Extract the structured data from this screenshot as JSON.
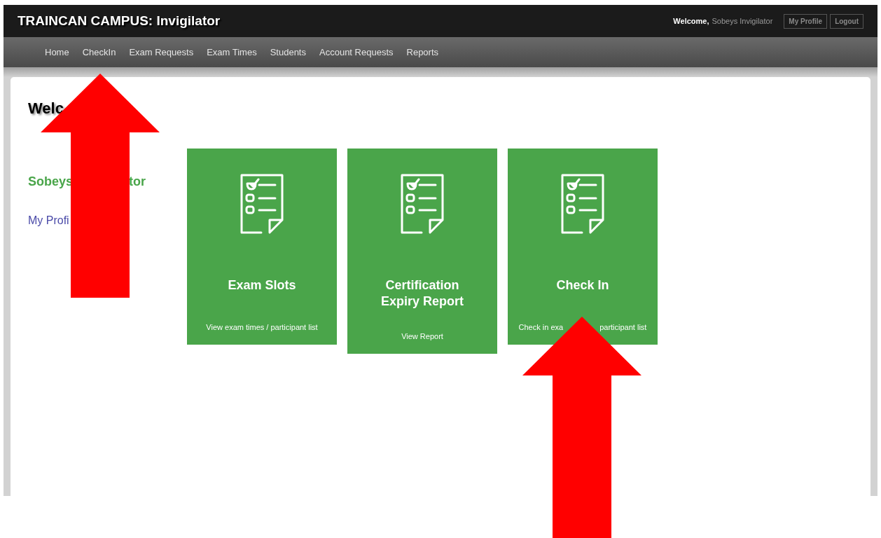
{
  "header": {
    "title": "TRAINCAN CAMPUS: Invigilator",
    "welcome_label": "Welcome,",
    "user_name": "Sobeys Invigilator",
    "buttons": [
      "My Profile",
      "Logout"
    ]
  },
  "nav": {
    "items": [
      "Home",
      "CheckIn",
      "Exam Requests",
      "Exam Times",
      "Students",
      "Account Requests",
      "Reports"
    ]
  },
  "main": {
    "heading": "Welc",
    "user_parts": [
      "Sobeys",
      "tor"
    ],
    "profile_link": "My Profi"
  },
  "cards": [
    {
      "title": "Exam Slots",
      "subtitle_parts": [
        "View exam times / participant list"
      ]
    },
    {
      "title": "Certification Expiry Report",
      "subtitle_parts": [
        "View Report"
      ]
    },
    {
      "title": "Check In",
      "subtitle_parts": [
        "Check in exa",
        "participant list"
      ]
    }
  ],
  "annotations": [
    {
      "kind": "arrow"
    },
    {
      "kind": "arrow"
    }
  ]
}
